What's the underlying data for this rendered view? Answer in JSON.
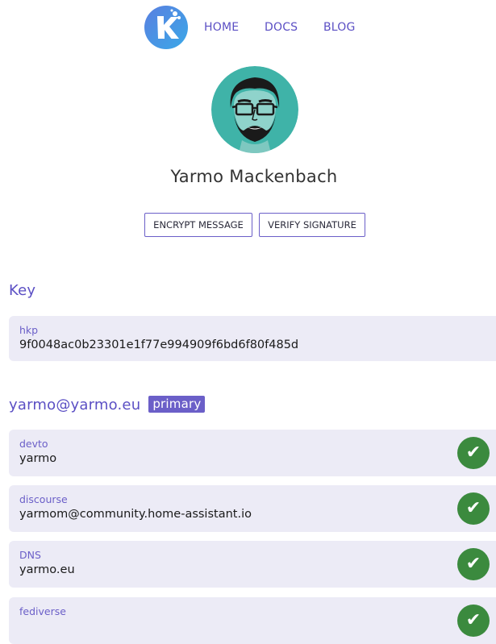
{
  "nav": {
    "home": "HOME",
    "docs": "DOCS",
    "blog": "BLOG"
  },
  "profile": {
    "name": "Yarmo Mackenbach",
    "buttons": {
      "encrypt": "ENCRYPT MESSAGE",
      "verify": "VERIFY SIGNATURE"
    }
  },
  "key_section": {
    "title": "Key",
    "protocol": "hkp",
    "fingerprint": "9f0048ac0b23301e1f77e994909f6bd6f80f485d"
  },
  "identity": {
    "email": "yarmo@yarmo.eu",
    "badge": "primary",
    "claims": [
      {
        "service": "devto",
        "value": "yarmo",
        "status": "verified"
      },
      {
        "service": "discourse",
        "value": "yarmom@community.home-assistant.io",
        "status": "verified"
      },
      {
        "service": "DNS",
        "value": "yarmo.eu",
        "status": "verified"
      },
      {
        "service": "fediverse",
        "value": "",
        "status": "verified"
      }
    ]
  },
  "icons": {
    "logo": "keyoxide-logo",
    "check": "✔"
  },
  "colors": {
    "accent": "#5b4fc4",
    "card_bg": "#ecebf6",
    "verified": "#3b8a3e",
    "avatar_bg": "#3fb3a8"
  }
}
